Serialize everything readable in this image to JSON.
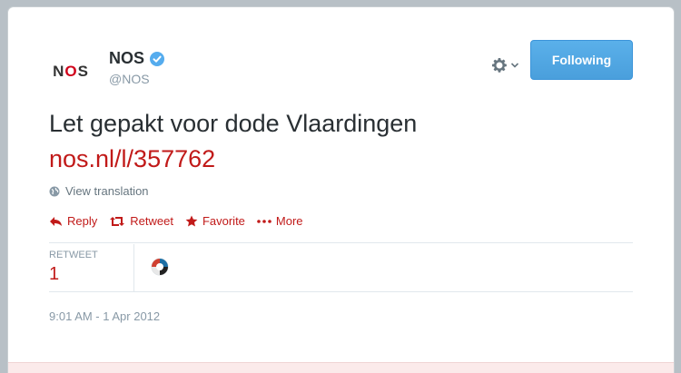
{
  "user": {
    "name": "NOS",
    "handle": "@NOS",
    "avatar_text_left": "N",
    "avatar_text_o": "O",
    "avatar_text_right": "S"
  },
  "header": {
    "follow_label": "Following",
    "gear_icon": "gear-icon"
  },
  "tweet": {
    "text": "Let gepakt voor dode Vlaardingen",
    "link": "nos.nl/l/357762",
    "translate_label": "View translation"
  },
  "actions": [
    {
      "label": "Reply",
      "icon": "reply-icon"
    },
    {
      "label": "Retweet",
      "icon": "retweet-icon"
    },
    {
      "label": "Favorite",
      "icon": "star-icon"
    },
    {
      "label": "More",
      "icon": "ellipsis-icon"
    }
  ],
  "stats": {
    "retweet_label": "RETWEET",
    "retweet_count": "1"
  },
  "timestamp": "9:01 AM - 1 Apr 2012",
  "colors": {
    "accent": "#c11a19",
    "follow_button": "#4a9fdc",
    "verified": "#55acee"
  }
}
